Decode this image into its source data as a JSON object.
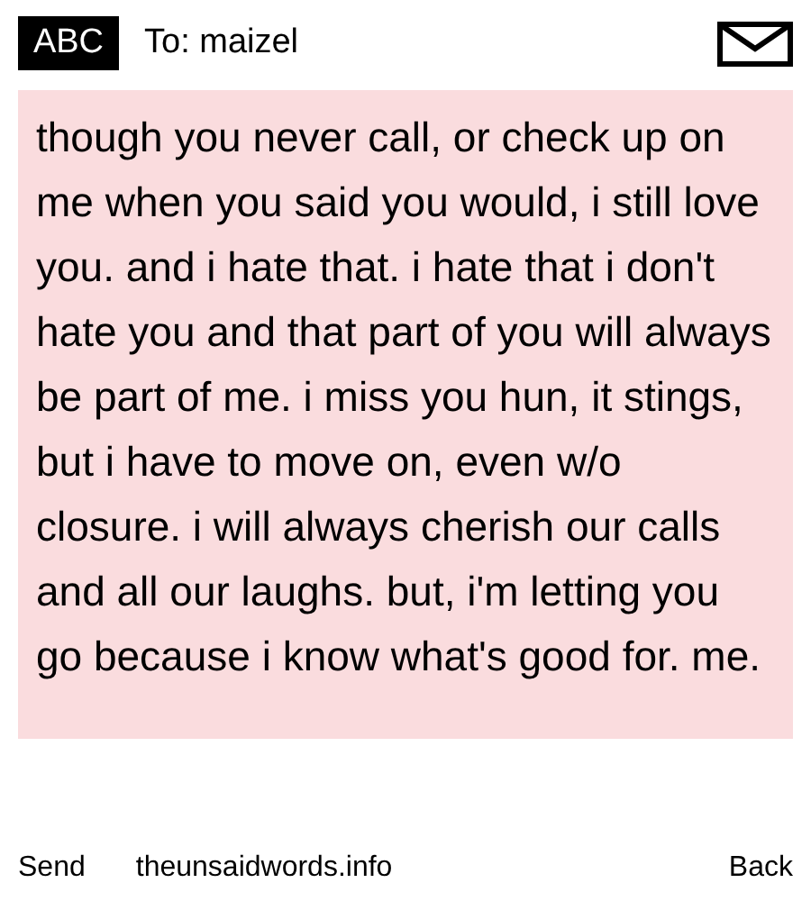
{
  "header": {
    "badge": "ABC",
    "recipient": "To: maizel"
  },
  "message": {
    "body": "though you never call, or check up on me when you said you would, i still love you. and i hate that. i hate that i don't hate you and that part of you will always be part of me. i miss you hun, it stings, but i have to move on, even w/o closure. i will always cherish our calls and all our laughs. but, i'm letting you go because i know what's good for. me."
  },
  "footer": {
    "send": "Send",
    "site": "theunsaidwords.info",
    "back": "Back"
  }
}
